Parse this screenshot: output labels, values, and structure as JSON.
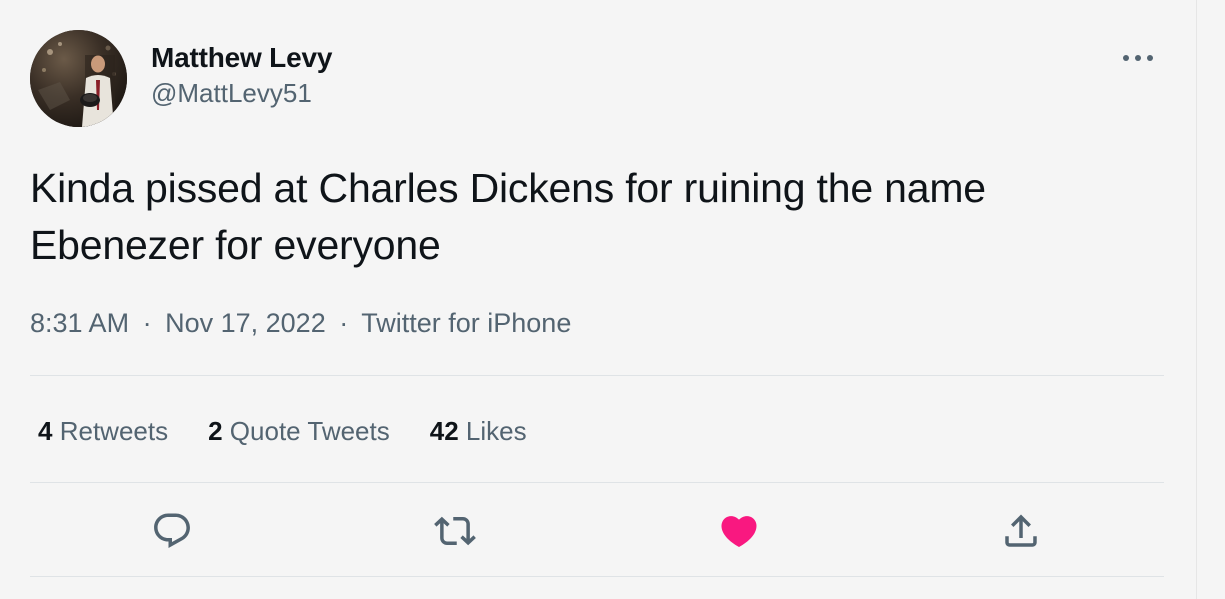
{
  "author": {
    "display_name": "Matthew Levy",
    "handle": "@MattLevy51",
    "avatar_icon": "user-avatar-photo"
  },
  "tweet": {
    "text": "Kinda pissed at Charles Dickens for ruining the name Ebenezer for everyone",
    "time": "8:31 AM",
    "date": "Nov 17, 2022",
    "source": "Twitter for iPhone",
    "separator": "·"
  },
  "stats": {
    "retweets": {
      "count": "4",
      "label": "Retweets"
    },
    "quote_tweets": {
      "count": "2",
      "label": "Quote Tweets"
    },
    "likes": {
      "count": "42",
      "label": "Likes"
    }
  },
  "actions": {
    "reply_icon": "reply-icon",
    "retweet_icon": "retweet-icon",
    "like_icon": "heart-icon",
    "share_icon": "share-icon",
    "liked": true
  },
  "colors": {
    "text_primary": "#0f1419",
    "text_secondary": "#536471",
    "like_active": "#f91880",
    "background": "#f5f5f5"
  }
}
